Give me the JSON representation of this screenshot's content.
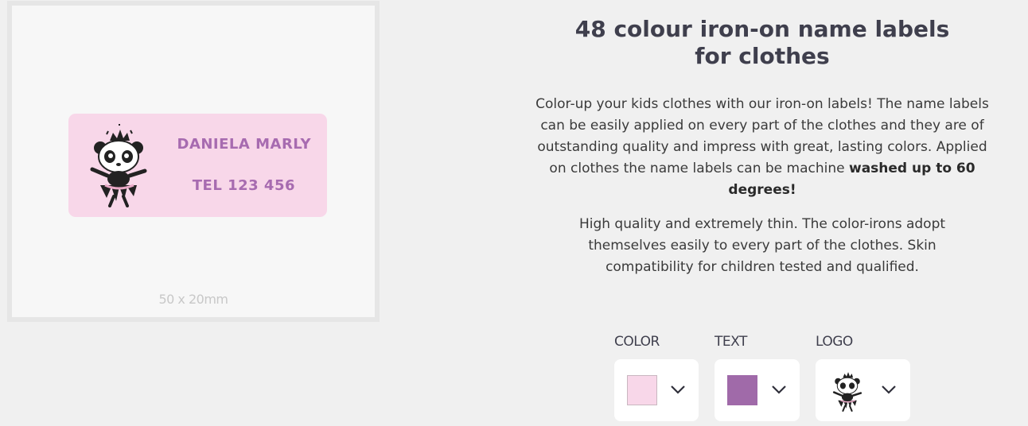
{
  "preview": {
    "name_line": "DANIELA MARLY",
    "phone_line": "TEL 123 456",
    "size_caption": "50 x 20mm",
    "background_color": "#f8d7e9",
    "text_color": "#a76bb0",
    "logo_icon": "ballerina-panda-icon"
  },
  "product": {
    "title": "48 colour iron-on name labels for clothes",
    "description_main": "Color-up your kids clothes with our iron-on labels! The name labels can be easily applied on every part of the clothes and they are of outstanding quality and impress with great, lasting colors. Applied on clothes the name labels can be machine",
    "description_bold": "washed up to 60 degrees!",
    "description_secondary": "High quality and extremely thin. The color-irons adopt themselves easily to every part of the clothes. Skin compatibility for children tested and qualified."
  },
  "options": {
    "color": {
      "label": "COLOR",
      "swatch": "#f8d7e9",
      "icon": "chevron-down-icon"
    },
    "text": {
      "label": "TEXT",
      "swatch": "#a06aa9",
      "icon": "chevron-down-icon"
    },
    "logo": {
      "label": "LOGO",
      "icon": "ballerina-panda-icon"
    }
  }
}
